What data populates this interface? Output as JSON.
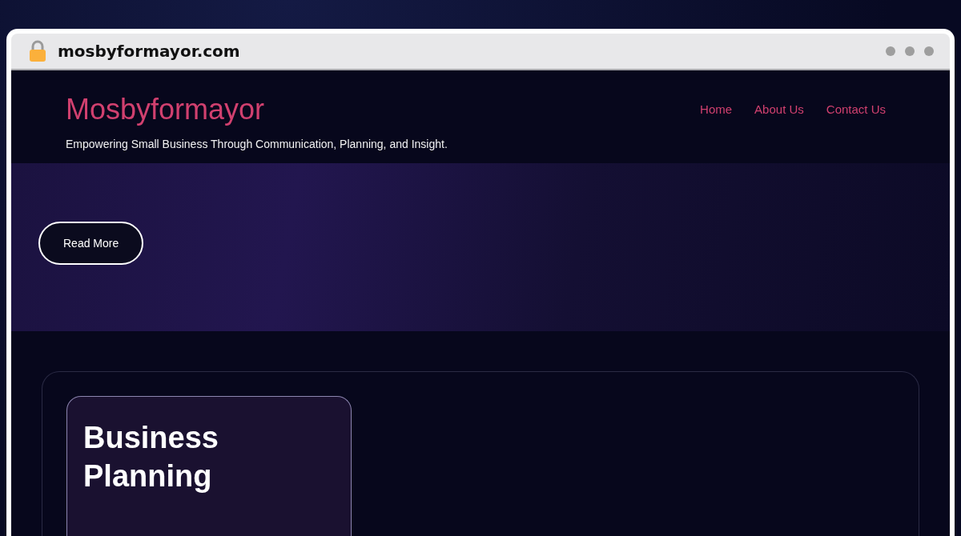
{
  "browser": {
    "url": "mosbyformayor.com"
  },
  "header": {
    "site_title": "Mosbyformayor",
    "tagline": "Empowering Small Business Through Communication, Planning, and Insight.",
    "nav": [
      {
        "label": "Home"
      },
      {
        "label": "About Us"
      },
      {
        "label": "Contact Us"
      }
    ]
  },
  "hero": {
    "button": "Read More"
  },
  "card": {
    "title": "Business Planning"
  }
}
